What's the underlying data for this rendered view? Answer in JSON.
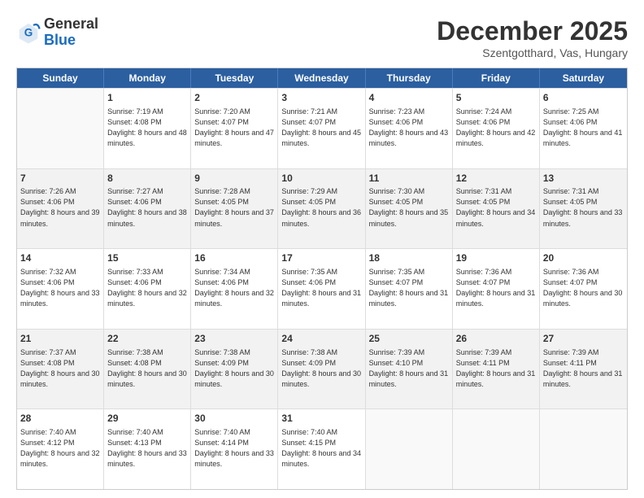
{
  "logo": {
    "general": "General",
    "blue": "Blue"
  },
  "header": {
    "month": "December 2025",
    "location": "Szentgotthard, Vas, Hungary"
  },
  "days": [
    "Sunday",
    "Monday",
    "Tuesday",
    "Wednesday",
    "Thursday",
    "Friday",
    "Saturday"
  ],
  "rows": [
    [
      {
        "day": "",
        "sunrise": "",
        "sunset": "",
        "daylight": ""
      },
      {
        "day": "1",
        "sunrise": "Sunrise: 7:19 AM",
        "sunset": "Sunset: 4:08 PM",
        "daylight": "Daylight: 8 hours and 48 minutes."
      },
      {
        "day": "2",
        "sunrise": "Sunrise: 7:20 AM",
        "sunset": "Sunset: 4:07 PM",
        "daylight": "Daylight: 8 hours and 47 minutes."
      },
      {
        "day": "3",
        "sunrise": "Sunrise: 7:21 AM",
        "sunset": "Sunset: 4:07 PM",
        "daylight": "Daylight: 8 hours and 45 minutes."
      },
      {
        "day": "4",
        "sunrise": "Sunrise: 7:23 AM",
        "sunset": "Sunset: 4:06 PM",
        "daylight": "Daylight: 8 hours and 43 minutes."
      },
      {
        "day": "5",
        "sunrise": "Sunrise: 7:24 AM",
        "sunset": "Sunset: 4:06 PM",
        "daylight": "Daylight: 8 hours and 42 minutes."
      },
      {
        "day": "6",
        "sunrise": "Sunrise: 7:25 AM",
        "sunset": "Sunset: 4:06 PM",
        "daylight": "Daylight: 8 hours and 41 minutes."
      }
    ],
    [
      {
        "day": "7",
        "sunrise": "Sunrise: 7:26 AM",
        "sunset": "Sunset: 4:06 PM",
        "daylight": "Daylight: 8 hours and 39 minutes."
      },
      {
        "day": "8",
        "sunrise": "Sunrise: 7:27 AM",
        "sunset": "Sunset: 4:06 PM",
        "daylight": "Daylight: 8 hours and 38 minutes."
      },
      {
        "day": "9",
        "sunrise": "Sunrise: 7:28 AM",
        "sunset": "Sunset: 4:05 PM",
        "daylight": "Daylight: 8 hours and 37 minutes."
      },
      {
        "day": "10",
        "sunrise": "Sunrise: 7:29 AM",
        "sunset": "Sunset: 4:05 PM",
        "daylight": "Daylight: 8 hours and 36 minutes."
      },
      {
        "day": "11",
        "sunrise": "Sunrise: 7:30 AM",
        "sunset": "Sunset: 4:05 PM",
        "daylight": "Daylight: 8 hours and 35 minutes."
      },
      {
        "day": "12",
        "sunrise": "Sunrise: 7:31 AM",
        "sunset": "Sunset: 4:05 PM",
        "daylight": "Daylight: 8 hours and 34 minutes."
      },
      {
        "day": "13",
        "sunrise": "Sunrise: 7:31 AM",
        "sunset": "Sunset: 4:05 PM",
        "daylight": "Daylight: 8 hours and 33 minutes."
      }
    ],
    [
      {
        "day": "14",
        "sunrise": "Sunrise: 7:32 AM",
        "sunset": "Sunset: 4:06 PM",
        "daylight": "Daylight: 8 hours and 33 minutes."
      },
      {
        "day": "15",
        "sunrise": "Sunrise: 7:33 AM",
        "sunset": "Sunset: 4:06 PM",
        "daylight": "Daylight: 8 hours and 32 minutes."
      },
      {
        "day": "16",
        "sunrise": "Sunrise: 7:34 AM",
        "sunset": "Sunset: 4:06 PM",
        "daylight": "Daylight: 8 hours and 32 minutes."
      },
      {
        "day": "17",
        "sunrise": "Sunrise: 7:35 AM",
        "sunset": "Sunset: 4:06 PM",
        "daylight": "Daylight: 8 hours and 31 minutes."
      },
      {
        "day": "18",
        "sunrise": "Sunrise: 7:35 AM",
        "sunset": "Sunset: 4:07 PM",
        "daylight": "Daylight: 8 hours and 31 minutes."
      },
      {
        "day": "19",
        "sunrise": "Sunrise: 7:36 AM",
        "sunset": "Sunset: 4:07 PM",
        "daylight": "Daylight: 8 hours and 31 minutes."
      },
      {
        "day": "20",
        "sunrise": "Sunrise: 7:36 AM",
        "sunset": "Sunset: 4:07 PM",
        "daylight": "Daylight: 8 hours and 30 minutes."
      }
    ],
    [
      {
        "day": "21",
        "sunrise": "Sunrise: 7:37 AM",
        "sunset": "Sunset: 4:08 PM",
        "daylight": "Daylight: 8 hours and 30 minutes."
      },
      {
        "day": "22",
        "sunrise": "Sunrise: 7:38 AM",
        "sunset": "Sunset: 4:08 PM",
        "daylight": "Daylight: 8 hours and 30 minutes."
      },
      {
        "day": "23",
        "sunrise": "Sunrise: 7:38 AM",
        "sunset": "Sunset: 4:09 PM",
        "daylight": "Daylight: 8 hours and 30 minutes."
      },
      {
        "day": "24",
        "sunrise": "Sunrise: 7:38 AM",
        "sunset": "Sunset: 4:09 PM",
        "daylight": "Daylight: 8 hours and 30 minutes."
      },
      {
        "day": "25",
        "sunrise": "Sunrise: 7:39 AM",
        "sunset": "Sunset: 4:10 PM",
        "daylight": "Daylight: 8 hours and 31 minutes."
      },
      {
        "day": "26",
        "sunrise": "Sunrise: 7:39 AM",
        "sunset": "Sunset: 4:11 PM",
        "daylight": "Daylight: 8 hours and 31 minutes."
      },
      {
        "day": "27",
        "sunrise": "Sunrise: 7:39 AM",
        "sunset": "Sunset: 4:11 PM",
        "daylight": "Daylight: 8 hours and 31 minutes."
      }
    ],
    [
      {
        "day": "28",
        "sunrise": "Sunrise: 7:40 AM",
        "sunset": "Sunset: 4:12 PM",
        "daylight": "Daylight: 8 hours and 32 minutes."
      },
      {
        "day": "29",
        "sunrise": "Sunrise: 7:40 AM",
        "sunset": "Sunset: 4:13 PM",
        "daylight": "Daylight: 8 hours and 33 minutes."
      },
      {
        "day": "30",
        "sunrise": "Sunrise: 7:40 AM",
        "sunset": "Sunset: 4:14 PM",
        "daylight": "Daylight: 8 hours and 33 minutes."
      },
      {
        "day": "31",
        "sunrise": "Sunrise: 7:40 AM",
        "sunset": "Sunset: 4:15 PM",
        "daylight": "Daylight: 8 hours and 34 minutes."
      },
      {
        "day": "",
        "sunrise": "",
        "sunset": "",
        "daylight": ""
      },
      {
        "day": "",
        "sunrise": "",
        "sunset": "",
        "daylight": ""
      },
      {
        "day": "",
        "sunrise": "",
        "sunset": "",
        "daylight": ""
      }
    ]
  ]
}
